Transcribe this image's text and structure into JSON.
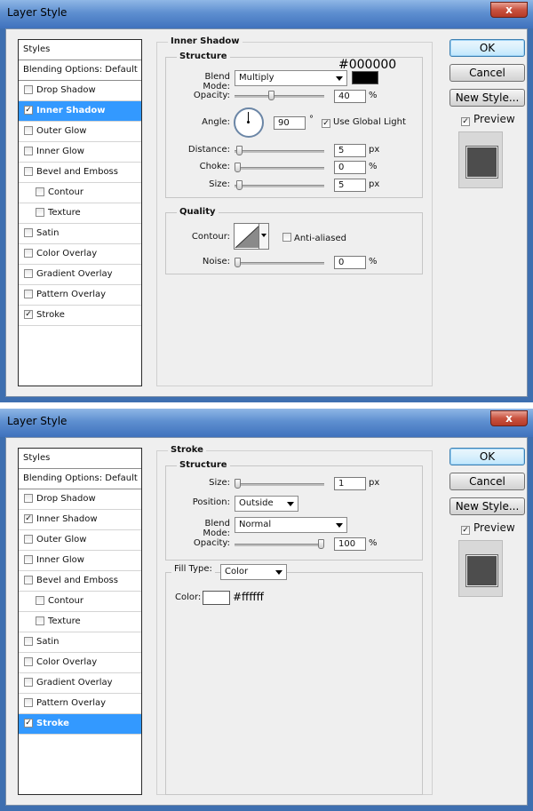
{
  "layer_styles": [
    "Styles",
    "Blending Options: Default",
    "Drop Shadow",
    "Inner Shadow",
    "Outer Glow",
    "Inner Glow",
    "Bevel and Emboss",
    "Contour",
    "Texture",
    "Satin",
    "Color Overlay",
    "Gradient Overlay",
    "Pattern Overlay",
    "Stroke"
  ],
  "buttons": {
    "ok": "OK",
    "cancel": "Cancel",
    "new_style": "New Style...",
    "preview": "Preview",
    "close": "x"
  },
  "window1": {
    "title": "Layer Style",
    "checked": {
      "drop_shadow": false,
      "inner_shadow": true,
      "outer_glow": false,
      "inner_glow": false,
      "bevel": false,
      "contour": false,
      "texture": false,
      "satin": false,
      "color_overlay": false,
      "gradient_overlay": false,
      "pattern_overlay": false,
      "stroke": true
    },
    "selected": "Inner Shadow",
    "panel_title": "Inner Shadow",
    "structure_title": "Structure",
    "blend_mode_label": "Blend Mode:",
    "blend_mode_value": "Multiply",
    "color_hex": "#000000",
    "color_swatch": "#000000",
    "opacity_label": "Opacity:",
    "opacity_value": "40",
    "opacity_unit": "%",
    "opacity_level": 0.4,
    "angle_label": "Angle:",
    "angle_value": "90",
    "angle_unit": "°",
    "use_global_light_label": "Use Global Light",
    "use_global_light_checked": true,
    "distance_label": "Distance:",
    "distance_value": "5",
    "distance_unit": "px",
    "distance_level": 0.02,
    "choke_label": "Choke:",
    "choke_value": "0",
    "choke_unit": "%",
    "choke_level": 0.0,
    "size_label": "Size:",
    "size_value": "5",
    "size_unit": "px",
    "size_level": 0.02,
    "quality_title": "Quality",
    "contour_label": "Contour:",
    "anti_aliased_label": "Anti-aliased",
    "anti_aliased_checked": false,
    "noise_label": "Noise:",
    "noise_value": "0",
    "noise_unit": "%",
    "noise_level": 0.0,
    "preview_checked": true
  },
  "window2": {
    "title": "Layer Style",
    "checked": {
      "drop_shadow": false,
      "inner_shadow": true,
      "outer_glow": false,
      "inner_glow": false,
      "bevel": false,
      "contour": false,
      "texture": false,
      "satin": false,
      "color_overlay": false,
      "gradient_overlay": false,
      "pattern_overlay": false,
      "stroke": true
    },
    "selected": "Stroke",
    "panel_title": "Stroke",
    "structure_title": "Structure",
    "size_label": "Size:",
    "size_value": "1",
    "size_unit": "px",
    "size_level": 0.0,
    "position_label": "Position:",
    "position_value": "Outside",
    "blend_mode_label": "Blend Mode:",
    "blend_mode_value": "Normal",
    "opacity_label": "Opacity:",
    "opacity_value": "100",
    "opacity_unit": "%",
    "opacity_level": 1.0,
    "fill_type_label": "Fill Type:",
    "fill_type_value": "Color",
    "color_label": "Color:",
    "color_hex": "#ffffff",
    "color_swatch": "#ffffff",
    "preview_checked": true
  }
}
